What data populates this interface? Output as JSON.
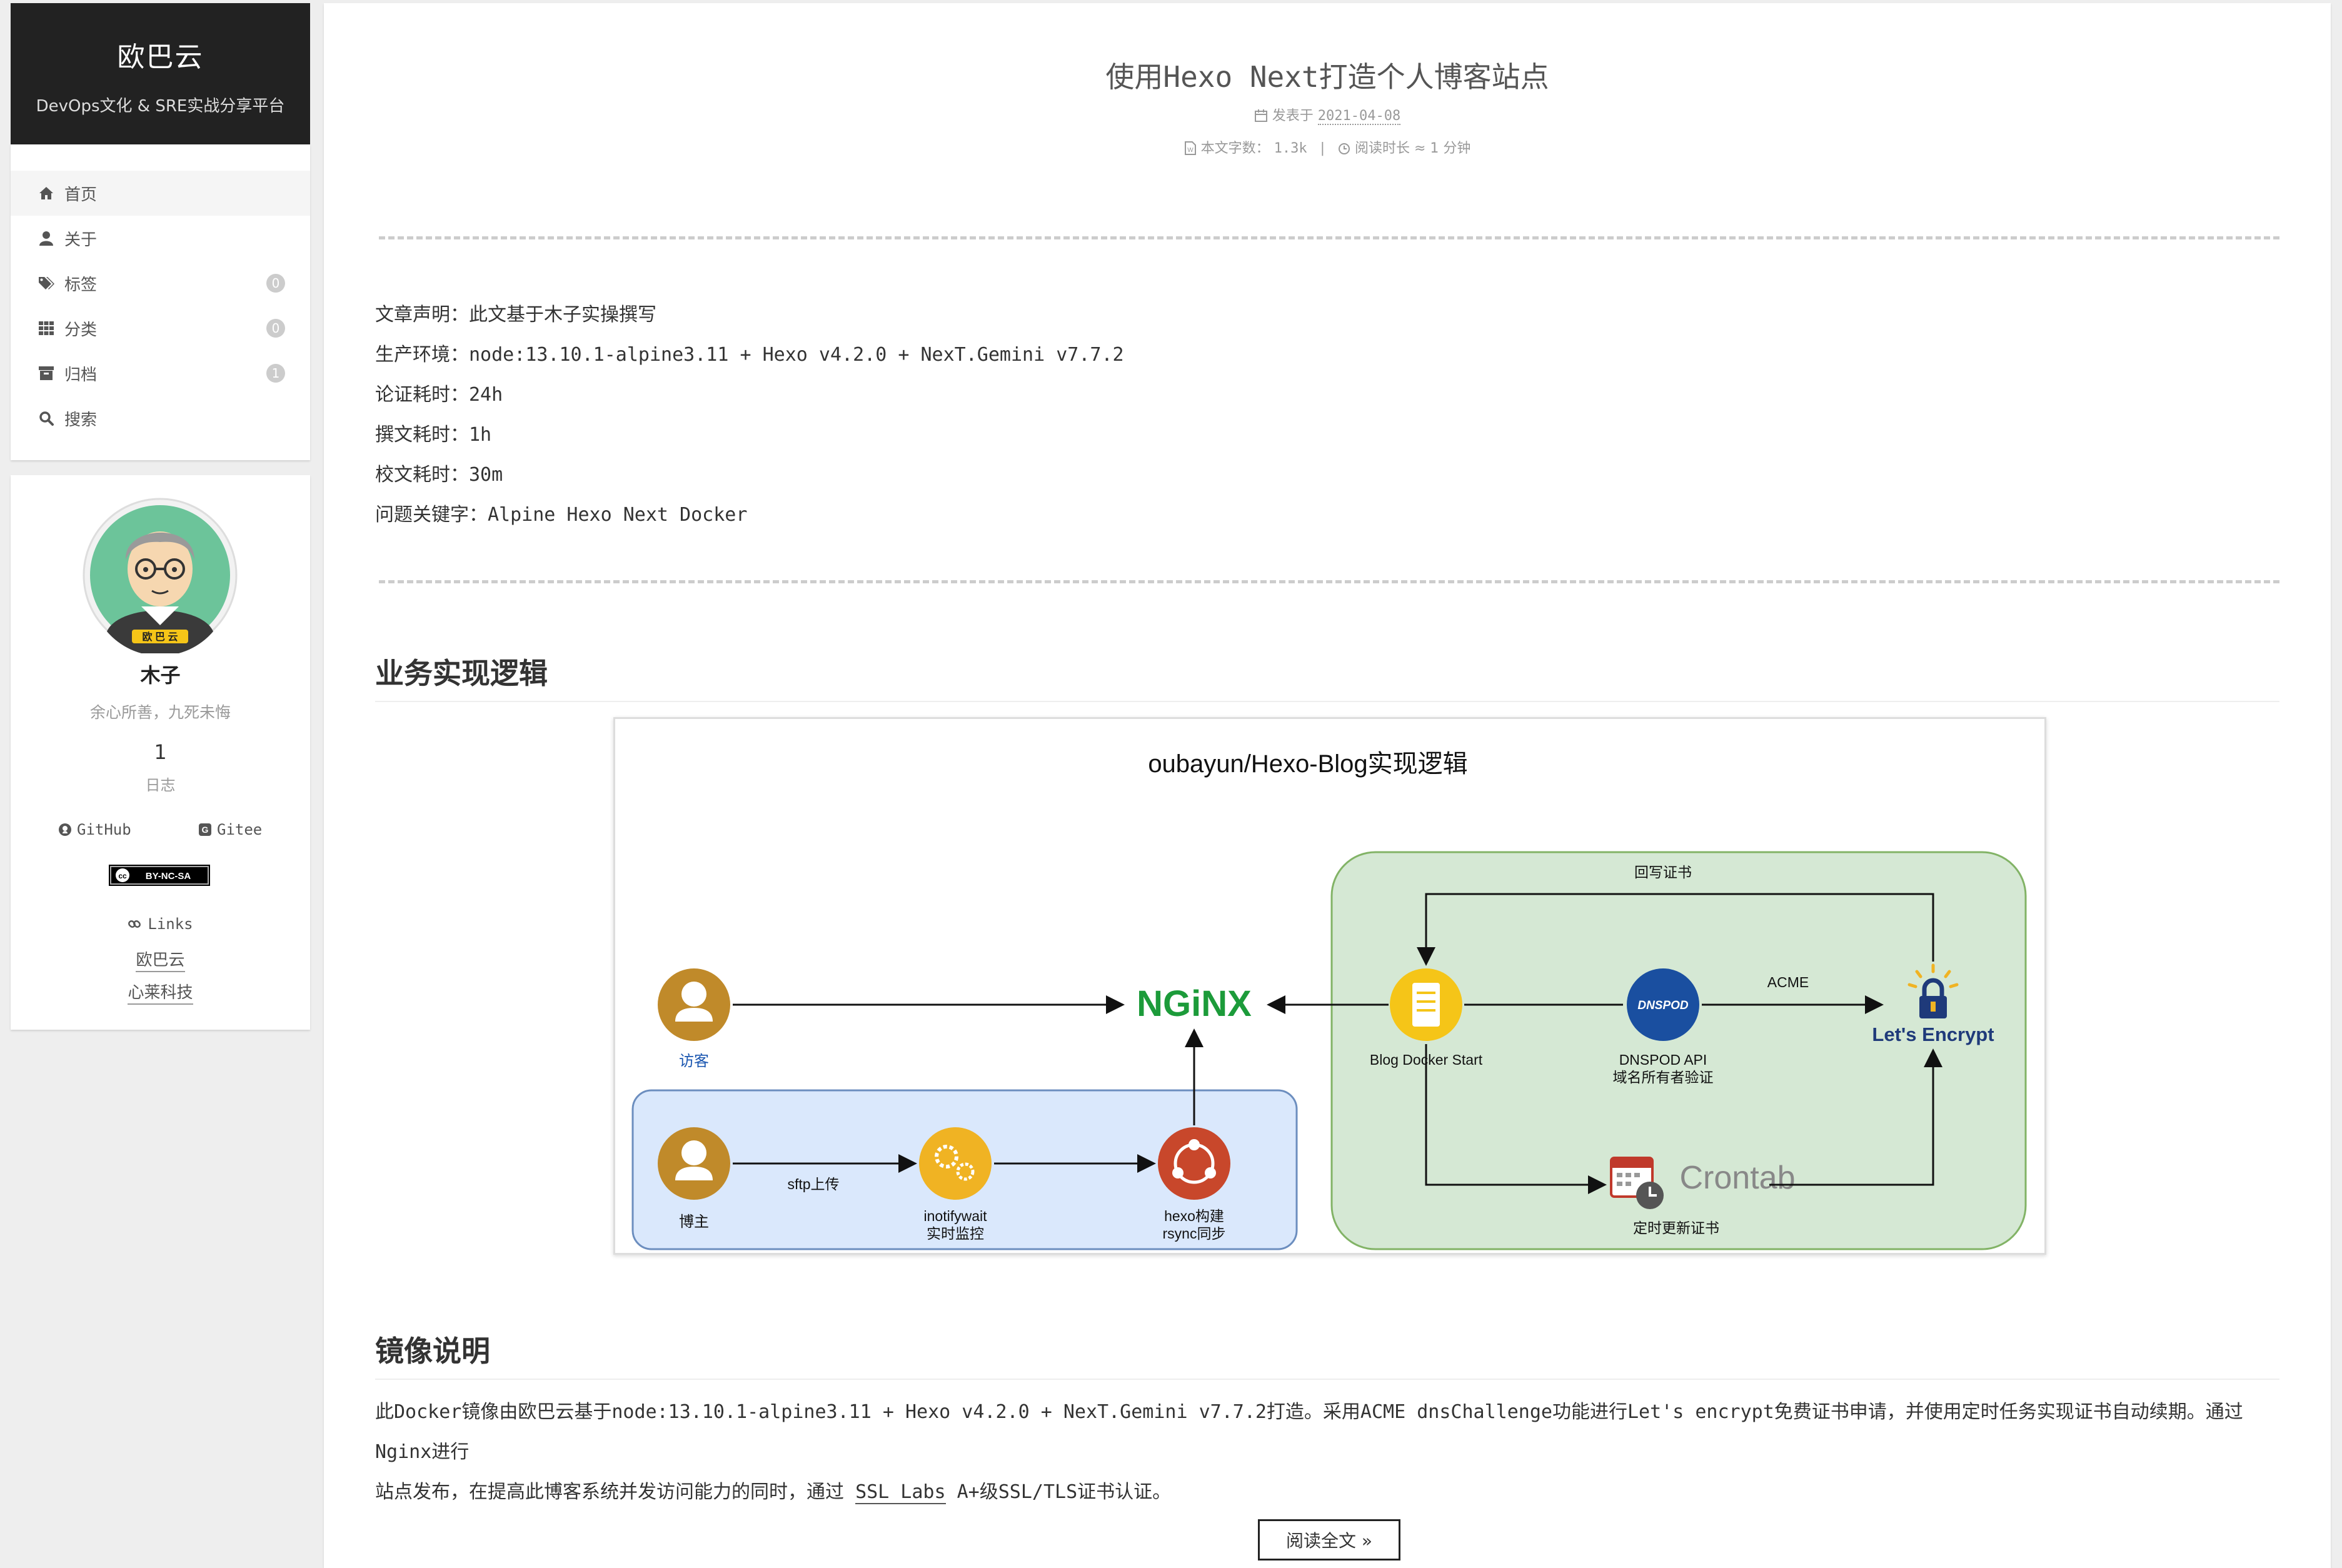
{
  "site": {
    "title": "欧巴云",
    "subtitle": "DevOps文化 & SRE实战分享平台"
  },
  "menu": [
    {
      "label": "首页",
      "icon": "home-icon",
      "badge": null
    },
    {
      "label": "关于",
      "icon": "user-icon",
      "badge": null
    },
    {
      "label": "标签",
      "icon": "tags-icon",
      "badge": "0"
    },
    {
      "label": "分类",
      "icon": "th-icon",
      "badge": "0"
    },
    {
      "label": "归档",
      "icon": "archive-icon",
      "badge": "1"
    },
    {
      "label": "搜索",
      "icon": "search-icon",
      "badge": null
    }
  ],
  "profile": {
    "avatar_text": "欧 巴 云",
    "name": "木子",
    "motto": "余心所善，九死未悔",
    "posts_count": "1",
    "posts_label": "日志",
    "github": "GitHub",
    "gitee": "Gitee",
    "license": "BY-NC-SA",
    "links_title": "Links",
    "links": [
      "欧巴云",
      "心莱科技"
    ]
  },
  "post": {
    "title": "使用Hexo Next打造个人博客站点",
    "posted_label": "发表于",
    "date": "2021-04-08",
    "wordcount_label": "本文字数：",
    "wordcount": "1.3k",
    "separator": "|",
    "readtime_label": "阅读时长 ≈",
    "readtime": "1 分钟",
    "declaration": [
      "文章声明：此文基于木子实操撰写",
      "生产环境：node:13.10.1-alpine3.11 + Hexo v4.2.0 + NexT.Gemini v7.7.2",
      "论证耗时：24h",
      "撰文耗时：1h",
      "校文耗时：30m",
      "问题关键字：Alpine Hexo Next Docker"
    ],
    "section1": "业务实现逻辑",
    "section2": "镜像说明",
    "para_line1": "此Docker镜像由欧巴云基于node:13.10.1-alpine3.11 + Hexo v4.2.0 + NexT.Gemini v7.7.2打造。采用ACME dnsChallenge功能进行Let's encrypt免费证书申请，并使用定时任务实现证书自动续期。通过Nginx进行",
    "para_line2_a": "站点发布，在提高此博客系统并发访问能力的同时，通过 ",
    "para_link": "SSL Labs",
    "para_line2_b": " A+级SSL/TLS证书认证。",
    "read_more": "阅读全文 »"
  },
  "diagram": {
    "title": "oubayun/Hexo-Blog实现逻辑",
    "visitor": "访客",
    "blogger": "博主",
    "sftp": "sftp上传",
    "inotify_1": "inotifywait",
    "inotify_2": "实时监控",
    "hexo_1": "hexo构建",
    "hexo_2": "rsync同步",
    "nginx": "NGiNX",
    "blog_docker": "Blog Docker Start",
    "dnspod_logo": "DNSPOD",
    "dnspod_1": "DNSPOD API",
    "dnspod_2": "域名所有者验证",
    "acme": "ACME",
    "letsencrypt": "Let's Encrypt",
    "writeback": "回写证书",
    "crontab": "Crontab",
    "crontab_label": "定时更新证书"
  },
  "colors": {
    "sidebar_header": "#222222",
    "nginx_green": "#1c9b3a",
    "letsencrypt_blue": "#1f3a7a",
    "person_gold": "#c08a2a",
    "green_zone": "#d5e8d4",
    "blue_zone": "#dae8fc"
  }
}
